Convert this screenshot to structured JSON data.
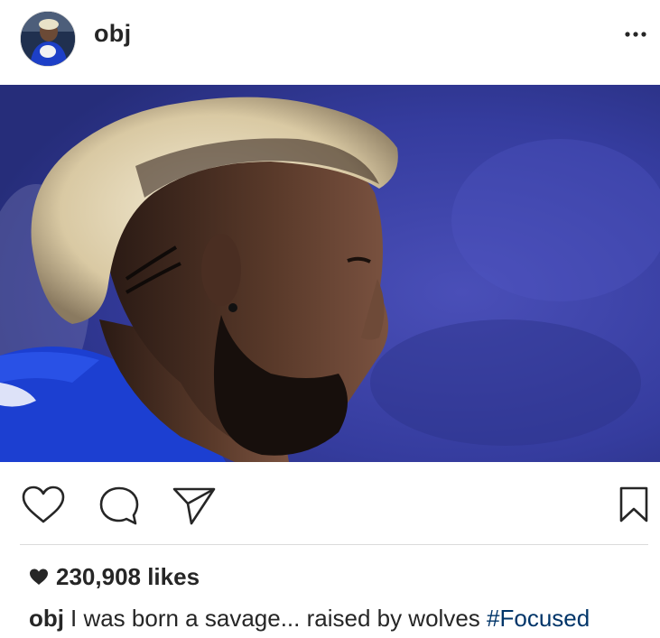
{
  "post": {
    "username": "obj",
    "likes_count_text": "230,908 likes",
    "caption": {
      "username": "obj",
      "text": "I was born a savage... raised by wolves",
      "hashtag": "#Focused"
    }
  },
  "icons": {
    "more": "more-horizontal-icon",
    "like": "heart-outline-icon",
    "comment": "comment-bubble-icon",
    "share": "paper-plane-icon",
    "save": "bookmark-icon",
    "likes": "heart-filled-icon"
  },
  "colors": {
    "text": "#262626",
    "hashtag": "#003569",
    "divider": "#dbdbdb",
    "photo_background": "#3a3fa8",
    "jersey": "#1c3fd1"
  }
}
